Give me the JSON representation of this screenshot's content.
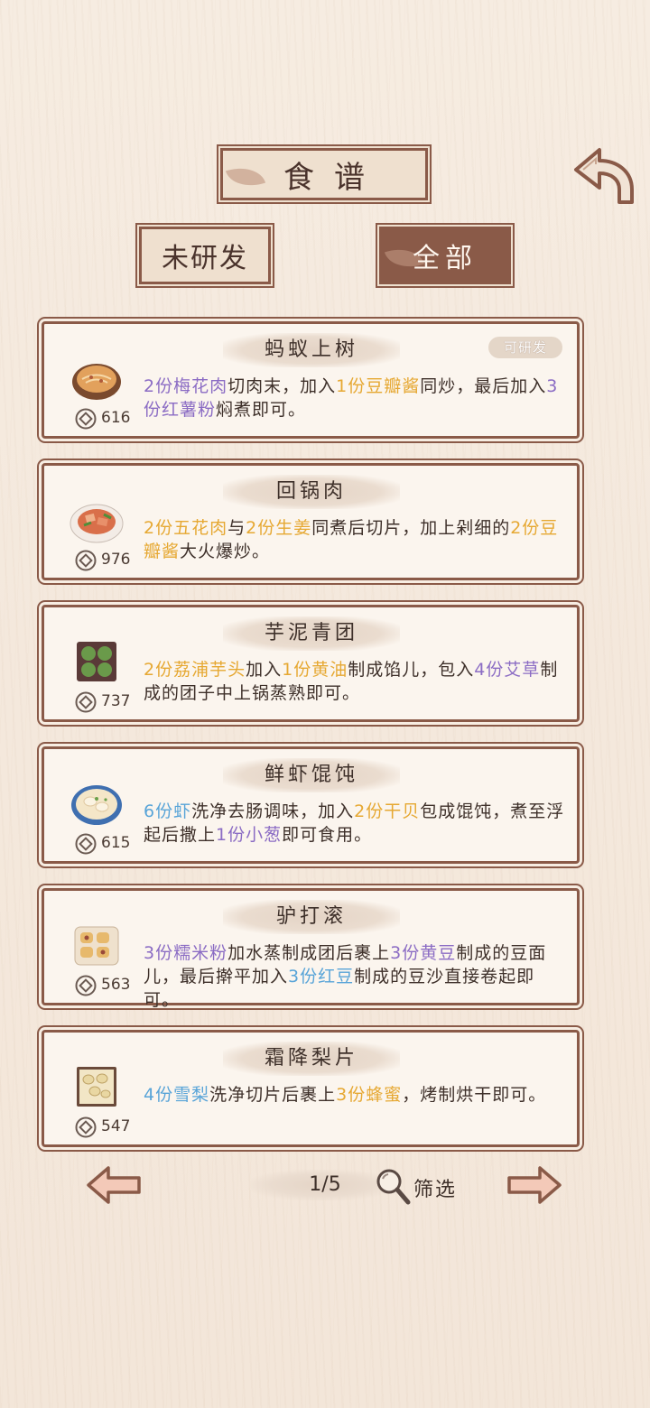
{
  "header": {
    "title": "食谱"
  },
  "tabs": [
    {
      "label": "未研发",
      "active": false
    },
    {
      "label": "全部",
      "active": true
    }
  ],
  "recipes": [
    {
      "name": "蚂蚁上树",
      "count": "616",
      "badge": "可研发",
      "dish_icon": "minced-pork-noodles-bowl",
      "description": [
        {
          "text": "2份梅花肉",
          "color": "purple"
        },
        {
          "text": "切肉末，加入",
          "color": "plain"
        },
        {
          "text": "1份豆瓣酱",
          "color": "orange"
        },
        {
          "text": "同炒，最后加入",
          "color": "plain"
        },
        {
          "text": "3份红薯粉",
          "color": "purple"
        },
        {
          "text": "焖煮即可。",
          "color": "plain"
        }
      ]
    },
    {
      "name": "回锅肉",
      "count": "976",
      "dish_icon": "twice-cooked-pork-plate",
      "description": [
        {
          "text": "2份五花肉",
          "color": "orange"
        },
        {
          "text": "与",
          "color": "plain"
        },
        {
          "text": "2份生姜",
          "color": "orange"
        },
        {
          "text": "同煮后切片，加上剁细的",
          "color": "plain"
        },
        {
          "text": "2份豆瓣酱",
          "color": "orange"
        },
        {
          "text": "大火爆炒。",
          "color": "plain"
        }
      ]
    },
    {
      "name": "芋泥青团",
      "count": "737",
      "dish_icon": "green-rice-balls-box",
      "description": [
        {
          "text": "2份荔浦芋头",
          "color": "orange"
        },
        {
          "text": "加入",
          "color": "plain"
        },
        {
          "text": "1份黄油",
          "color": "orange"
        },
        {
          "text": "制成馅儿，包入",
          "color": "plain"
        },
        {
          "text": "4份艾草",
          "color": "purple"
        },
        {
          "text": "制成的团子中上锅蒸熟即可。",
          "color": "plain"
        }
      ]
    },
    {
      "name": "鲜虾馄饨",
      "count": "615",
      "dish_icon": "wonton-soup-bowl",
      "description": [
        {
          "text": "6份虾",
          "color": "blue"
        },
        {
          "text": "洗净去肠调味，加入",
          "color": "plain"
        },
        {
          "text": "2份干贝",
          "color": "orange"
        },
        {
          "text": "包成馄饨，煮至浮起后撒上",
          "color": "plain"
        },
        {
          "text": "1份小葱",
          "color": "purple"
        },
        {
          "text": "即可食用。",
          "color": "plain"
        }
      ]
    },
    {
      "name": "驴打滚",
      "count": "563",
      "dish_icon": "rolled-bean-cakes-plate",
      "description": [
        {
          "text": "3份糯米粉",
          "color": "purple"
        },
        {
          "text": "加水蒸制成团后裹上",
          "color": "plain"
        },
        {
          "text": "3份黄豆",
          "color": "purple"
        },
        {
          "text": "制成的豆面儿，最后擀平加入",
          "color": "plain"
        },
        {
          "text": "3份红豆",
          "color": "blue"
        },
        {
          "text": "制成的豆沙直接卷起即可。",
          "color": "plain"
        }
      ]
    },
    {
      "name": "霜降梨片",
      "count": "547",
      "dish_icon": "pear-chips-tray",
      "description": [
        {
          "text": "4份雪梨",
          "color": "blue"
        },
        {
          "text": "洗净切片后裹上",
          "color": "plain"
        },
        {
          "text": "3份蜂蜜",
          "color": "orange"
        },
        {
          "text": "，烤制烘干即可。",
          "color": "plain"
        }
      ]
    }
  ],
  "pagination": {
    "indicator": "1/5",
    "filter_label": "筛选"
  },
  "colors": {
    "frame": "#8a5a48",
    "purple": "#8b6cc4",
    "orange": "#e6a832",
    "blue": "#58a4d8"
  }
}
